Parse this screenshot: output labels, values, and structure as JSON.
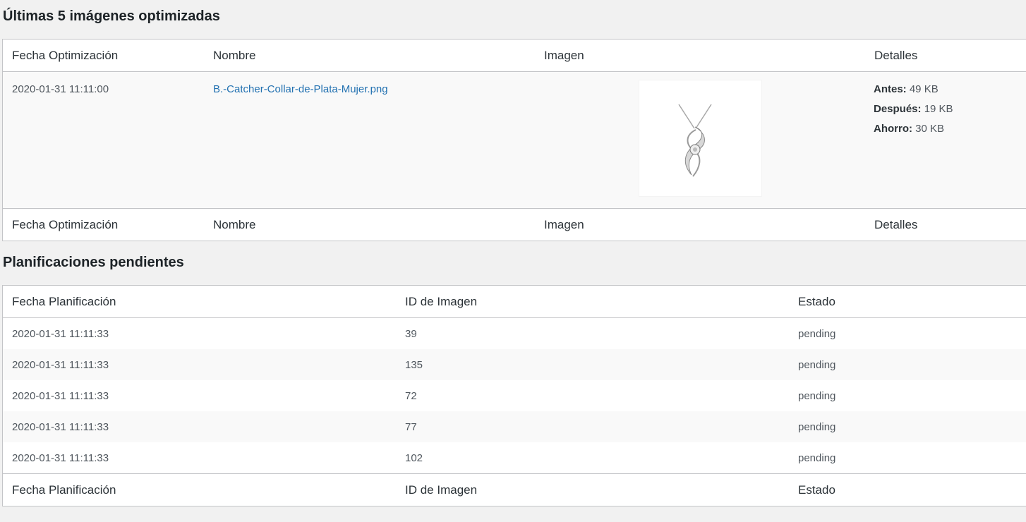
{
  "optimized": {
    "title": "Últimas 5 imágenes optimizadas",
    "columns": [
      "Fecha Optimización",
      "Nombre",
      "Imagen",
      "Detalles"
    ],
    "rows": [
      {
        "date": "2020-01-31 11:11:00",
        "name": "B.-Catcher-Collar-de-Plata-Mujer.png",
        "image_icon": "necklace-pendant-thumbnail",
        "details": {
          "before_label": "Antes:",
          "before_value": " 49 KB",
          "after_label": "Después:",
          "after_value": " 19 KB",
          "saving_label": "Ahorro:",
          "saving_value": " 30 KB"
        }
      }
    ]
  },
  "scheduled": {
    "title": "Planificaciones pendientes",
    "columns": [
      "Fecha Planificación",
      "ID de Imagen",
      "Estado"
    ],
    "rows": [
      {
        "date": "2020-01-31 11:11:33",
        "id": "39",
        "status": "pending"
      },
      {
        "date": "2020-01-31 11:11:33",
        "id": "135",
        "status": "pending"
      },
      {
        "date": "2020-01-31 11:11:33",
        "id": "72",
        "status": "pending"
      },
      {
        "date": "2020-01-31 11:11:33",
        "id": "77",
        "status": "pending"
      },
      {
        "date": "2020-01-31 11:11:33",
        "id": "102",
        "status": "pending"
      }
    ]
  },
  "colors": {
    "link": "#2271b1",
    "border": "#c3c4c7",
    "background": "#f1f1f1"
  }
}
